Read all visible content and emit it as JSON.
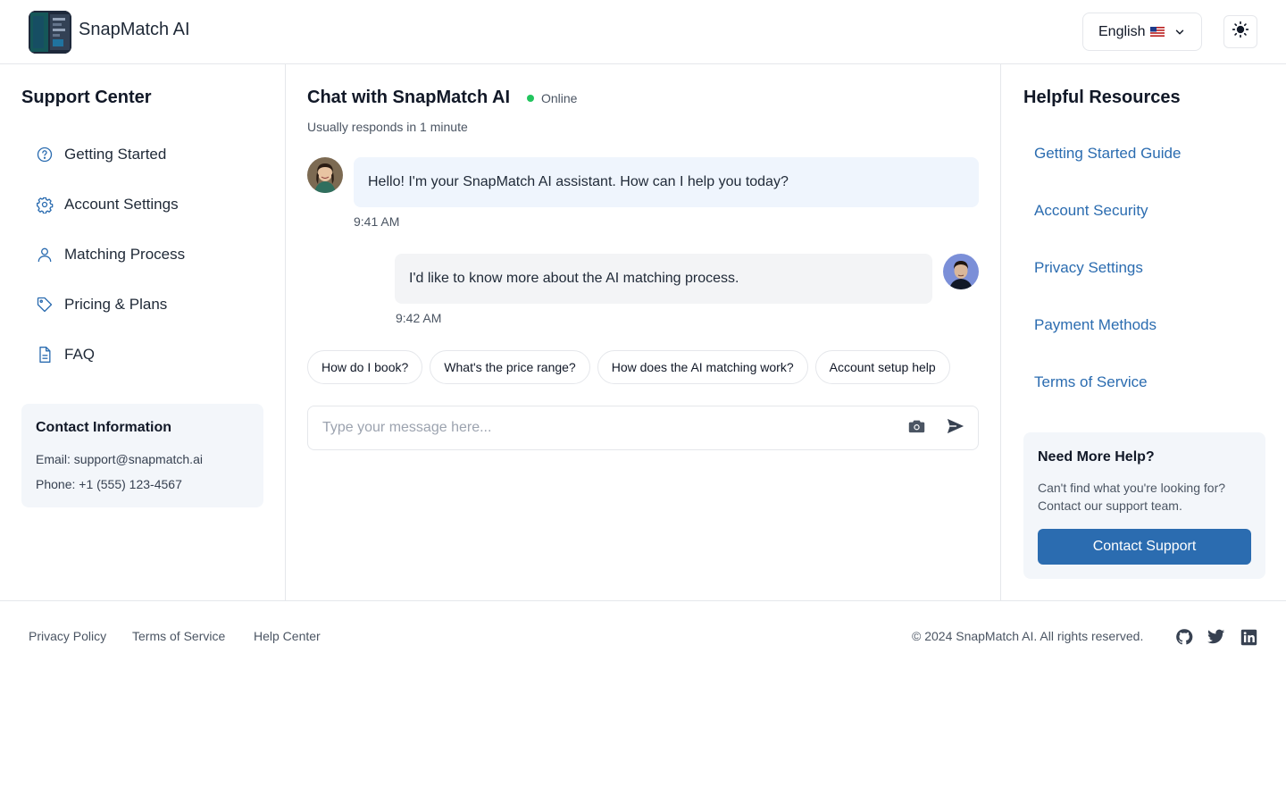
{
  "header": {
    "brand": "SnapMatch AI",
    "language": "English",
    "language_flag": "🇺🇸"
  },
  "left_sidebar": {
    "title": "Support Center",
    "items": [
      {
        "label": "Getting Started",
        "icon": "question-circle-icon"
      },
      {
        "label": "Account Settings",
        "icon": "gear-icon"
      },
      {
        "label": "Matching Process",
        "icon": "user-icon"
      },
      {
        "label": "Pricing & Plans",
        "icon": "tag-icon"
      },
      {
        "label": "FAQ",
        "icon": "document-icon"
      }
    ],
    "contact": {
      "title": "Contact Information",
      "email": "Email: support@snapmatch.ai",
      "phone": "Phone: +1 (555) 123-4567"
    }
  },
  "chat": {
    "title": "Chat with SnapMatch AI",
    "status": "Online",
    "responds": "Usually responds in 1 minute",
    "messages": [
      {
        "sender": "ai",
        "text": "Hello! I'm your SnapMatch AI assistant. How can I help you today?",
        "time": "9:41 AM"
      },
      {
        "sender": "user",
        "text": "I'd like to know more about the AI matching process.",
        "time": "9:42 AM"
      }
    ],
    "suggestions": [
      "How do I book?",
      "What's the price range?",
      "How does the AI matching work?",
      "Account setup help"
    ],
    "input_placeholder": "Type your message here..."
  },
  "right_sidebar": {
    "title": "Helpful Resources",
    "links": [
      "Getting Started Guide",
      "Account Security",
      "Privacy Settings",
      "Payment Methods",
      "Terms of Service"
    ],
    "help": {
      "title": "Need More Help?",
      "text": "Can't find what you're looking for? Contact our support team.",
      "button": "Contact Support"
    }
  },
  "footer": {
    "links": [
      "Privacy Policy",
      "Terms of Service",
      "Help Center"
    ],
    "copyright": "© 2024 SnapMatch AI. All rights reserved.",
    "social": [
      "github-icon",
      "twitter-icon",
      "linkedin-icon"
    ]
  },
  "colors": {
    "accent": "#2b6cb0",
    "online": "#22c55e",
    "ai_bubble": "#eff5fd",
    "user_bubble": "#f3f4f6",
    "panel_bg": "#f3f6fa"
  }
}
